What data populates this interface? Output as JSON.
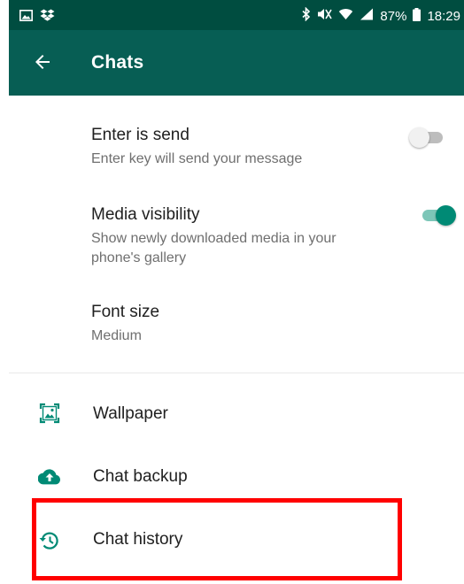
{
  "status_bar": {
    "left_icons": [
      "image-icon",
      "dropbox-icon"
    ],
    "right_icons": [
      "bluetooth-icon",
      "mute-icon",
      "wifi-icon",
      "signal-icon"
    ],
    "battery": "87%",
    "time": "18:29"
  },
  "header": {
    "back_icon": "arrow-left-icon",
    "title": "Chats"
  },
  "settings": [
    {
      "title": "Enter is send",
      "subtitle": "Enter key will send your message",
      "toggle_on": false
    },
    {
      "title": "Media visibility",
      "subtitle_line1": "Show newly downloaded media in your",
      "subtitle_line2": "phone's gallery",
      "toggle_on": true
    },
    {
      "title": "Font size",
      "subtitle": "Medium"
    }
  ],
  "menu": [
    {
      "label": "Wallpaper",
      "icon": "wallpaper-icon"
    },
    {
      "label": "Chat backup",
      "icon": "cloud-upload-icon"
    },
    {
      "label": "Chat history",
      "icon": "history-icon"
    }
  ],
  "colors": {
    "status_bar": "#004d40",
    "app_bar": "#075e54",
    "accent": "#008a75",
    "highlight": "#ff0000"
  }
}
